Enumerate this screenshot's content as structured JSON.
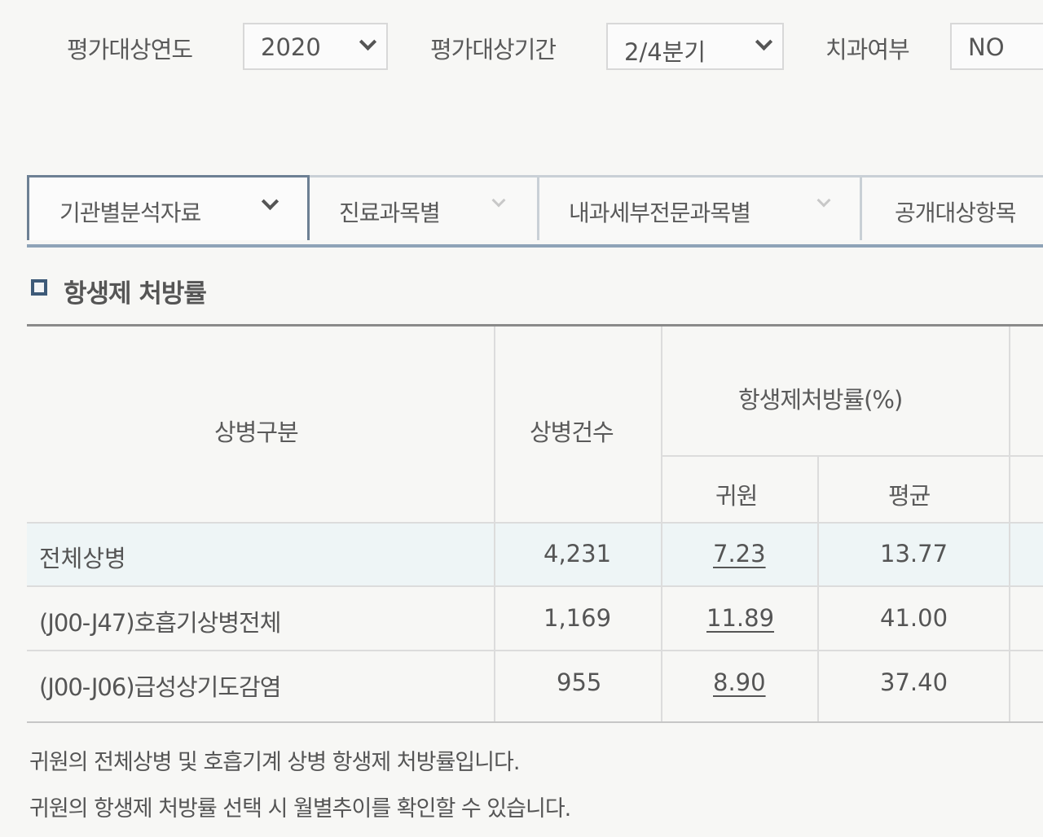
{
  "filters": {
    "year_label": "평가대상연도",
    "year_value": "2020",
    "period_label": "평가대상기간",
    "period_value": "2/4분기",
    "dental_label": "치과여부",
    "dental_value": "NO"
  },
  "tabs": [
    {
      "label": "기관별분석자료",
      "active": true
    },
    {
      "label": "진료과목별",
      "active": false
    },
    {
      "label": "내과세부전문과목별",
      "active": false
    },
    {
      "label": "공개대상항목",
      "active": false
    }
  ],
  "section": {
    "title": "항생제 처방률"
  },
  "table": {
    "headers": {
      "category": "상병구분",
      "count": "상병건수",
      "rate_group": "항생제처방률(%)",
      "yours": "귀원",
      "average": "평균"
    },
    "rows": [
      {
        "category": "전체상병",
        "count": "4,231",
        "yours": "7.23",
        "average": "13.77"
      },
      {
        "category": "(J00-J47)호흡기상병전체",
        "count": "1,169",
        "yours": "11.89",
        "average": "41.00"
      },
      {
        "category": "(J00-J06)급성상기도감염",
        "count": "955",
        "yours": "8.90",
        "average": "37.40"
      }
    ]
  },
  "notes": [
    "귀원의 전체상병 및 호흡기계 상병 항생제 처방률입니다.",
    "귀원의 항생제 처방률 선택 시 월별추이를 확인할 수 있습니다."
  ]
}
